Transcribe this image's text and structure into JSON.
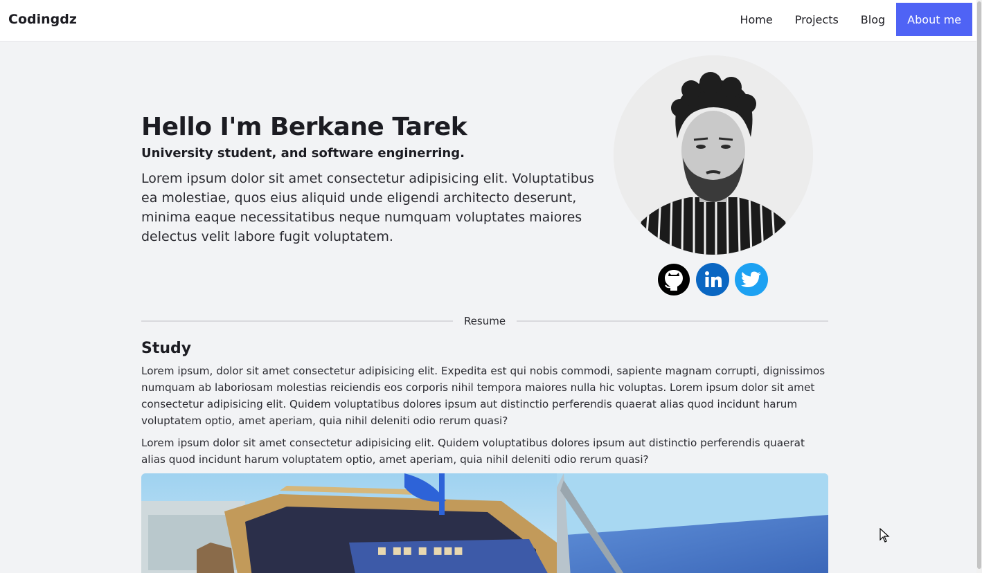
{
  "navbar": {
    "brand": "Codingdz",
    "links": [
      {
        "label": "Home",
        "active": false
      },
      {
        "label": "Projects",
        "active": false
      },
      {
        "label": "Blog",
        "active": false
      },
      {
        "label": "About me",
        "active": true
      }
    ]
  },
  "hero": {
    "title": "Hello I'm Berkane Tarek",
    "subtitle": "University student, and software enginerring.",
    "description": "Lorem ipsum dolor sit amet consectetur adipisicing elit. Voluptatibus ea molestiae, quos eius aliquid unde eligendi architecto deserunt, minima eaque necessitatibus neque numquam voluptates maiores delectus velit labore fugit voluptatem."
  },
  "socials": [
    {
      "name": "github-icon",
      "color": "#000000"
    },
    {
      "name": "linkedin-icon",
      "color": "#0a66c2"
    },
    {
      "name": "twitter-icon",
      "color": "#1da1f2"
    }
  ],
  "resume": {
    "divider_label": "Resume",
    "study_heading": "Study",
    "paragraphs": [
      "Lorem ipsum, dolor sit amet consectetur adipisicing elit. Expedita est qui nobis commodi, sapiente magnam corrupti, dignissimos numquam ab laboriosam molestias reiciendis eos corporis nihil tempora maiores nulla hic voluptas. Lorem ipsum dolor sit amet consectetur adipisicing elit. Quidem voluptatibus dolores ipsum aut distinctio perferendis quaerat alias quod incidunt harum voluptatem optio, amet aperiam, quia nihil deleniti odio rerum quasi?",
      "Lorem ipsum dolor sit amet consectetur adipisicing elit. Quidem voluptatibus dolores ipsum aut distinctio perferendis quaerat alias quod incidunt harum voluptatem optio, amet aperiam, quia nihil deleniti odio rerum quasi?"
    ]
  },
  "colors": {
    "accent": "#4f63f5",
    "page_background": "#f2f3f5"
  }
}
